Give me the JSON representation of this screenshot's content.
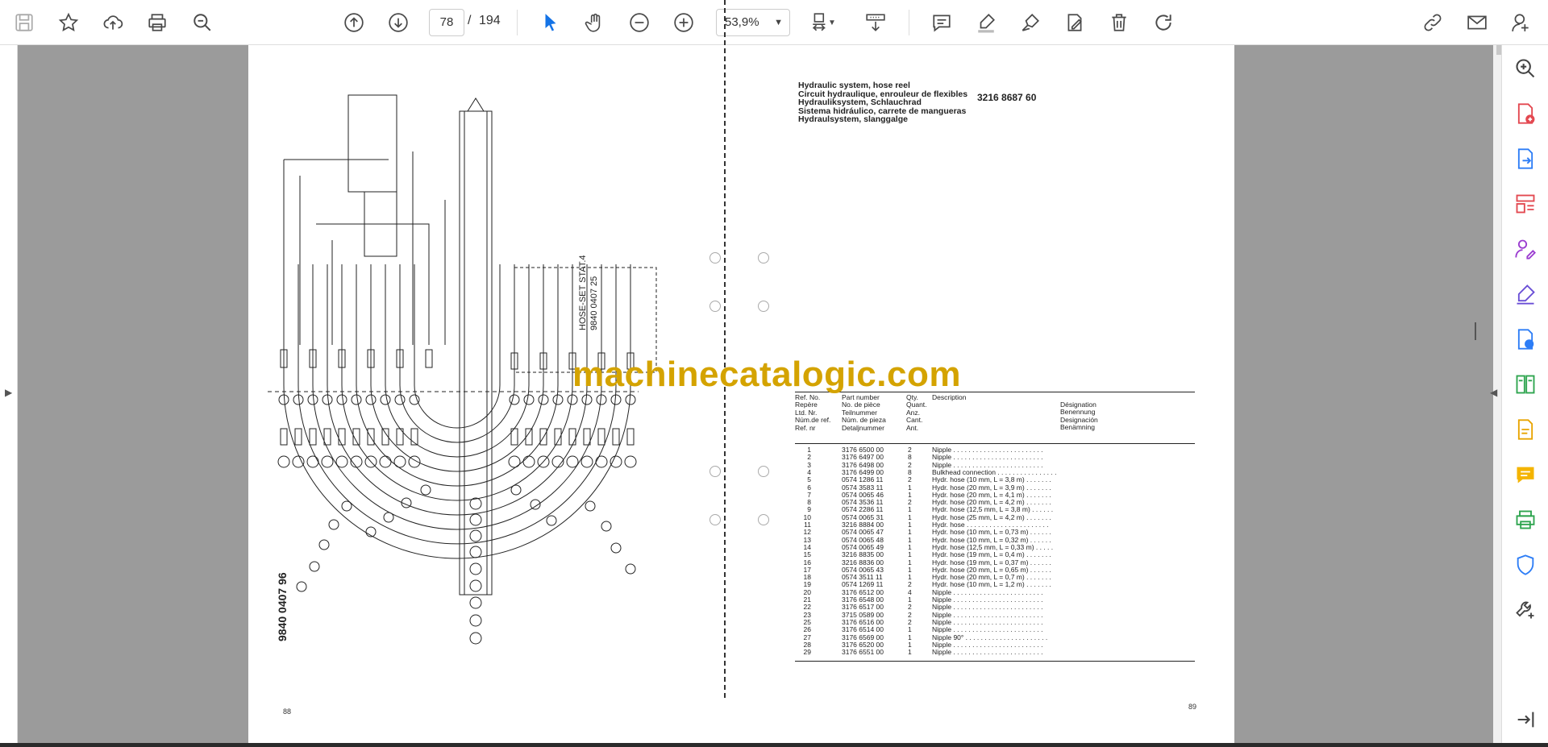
{
  "toolbar": {
    "page_current": "78",
    "page_separator": "/",
    "page_total": "194",
    "zoom": "53,9%",
    "icons": [
      "save-icon",
      "bookmark-star-icon",
      "upload-cloud-icon",
      "print-icon",
      "find-zoom-icon",
      "page-up-icon",
      "page-down-icon",
      "select-cursor-icon",
      "hand-pan-icon",
      "zoom-out-icon",
      "zoom-in-icon",
      "fit-page-icon",
      "scroll-mode-icon",
      "comment-icon",
      "highlight-pen-icon",
      "sign-icon",
      "edit-text-icon",
      "delete-trash-icon",
      "rotate-icon",
      "share-link-icon",
      "email-icon",
      "account-icon"
    ]
  },
  "right_panel": {
    "icons": [
      "zoom-search-icon",
      "create-pdf-icon",
      "export-pdf-icon",
      "organize-pages-icon",
      "request-signature-icon",
      "fill-sign-icon",
      "convert-pdf-icon",
      "compare-icon",
      "edit-pdf-icon",
      "comment-panel-icon",
      "print-production-icon",
      "protect-icon",
      "more-tools-icon",
      "expand-panel-icon"
    ]
  },
  "document": {
    "left_page_number": "88",
    "right_page_number": "89",
    "schematic_label": "9840 0407 96",
    "hoseset_label_1": "HOSE-SET STAT.4",
    "hoseset_label_2": "9840 0407 25",
    "watermark": "machinecatalogic.com",
    "title_lines": [
      "Hydraulic system, hose reel",
      "Circuit hydraulique, enrouleur de flexibles",
      "Hydrauliksystem, Schlauchrad",
      "Sistema hidráulico, carrete de mangueras",
      "Hydraulsystem, slanggalge"
    ],
    "title_part_number": "3216 8687 60",
    "header": {
      "ref": [
        "Ref. No.",
        "Repère",
        "Ltd. Nr.",
        "Núm.de ref.",
        "Ref. nr"
      ],
      "part": [
        "Part number",
        "No. de pièce",
        "Teilnummer",
        "Núm. de pieza",
        "Detaljnummer"
      ],
      "qty": [
        "Qty.",
        "Quant.",
        "Anz.",
        "Cant.",
        "Ant."
      ],
      "desc": "Description",
      "desc_lang": [
        "Désignation",
        "Benennung",
        "Designación",
        "Benämning"
      ]
    },
    "parts": [
      {
        "ref": "1",
        "part": "3176 6500 00",
        "qty": "2",
        "desc": "Nipple . . . . . . . . . . . . . . . . . . . . . . . ."
      },
      {
        "ref": "2",
        "part": "3176 6497 00",
        "qty": "8",
        "desc": "Nipple . . . . . . . . . . . . . . . . . . . . . . . ."
      },
      {
        "ref": "3",
        "part": "3176 6498 00",
        "qty": "2",
        "desc": "Nipple . . . . . . . . . . . . . . . . . . . . . . . ."
      },
      {
        "ref": "4",
        "part": "3176 6499 00",
        "qty": "8",
        "desc": "Bulkhead connection . . . . . . . . . . . . . . . ."
      },
      {
        "ref": "5",
        "part": "0574 1286 11",
        "qty": "2",
        "desc": "Hydr. hose (10 mm, L = 3,8 m) . . . . . . ."
      },
      {
        "ref": "6",
        "part": "0574 3583 11",
        "qty": "1",
        "desc": "Hydr. hose (20 mm, L = 3,9 m) . . . . . . ."
      },
      {
        "ref": "7",
        "part": "0574 0065 46",
        "qty": "1",
        "desc": "Hydr. hose (20 mm, L = 4,1 m) . . . . . . ."
      },
      {
        "ref": "8",
        "part": "0574 3536 11",
        "qty": "2",
        "desc": "Hydr. hose (20 mm, L = 4,2 m) . . . . . . ."
      },
      {
        "ref": "9",
        "part": "0574 2286 11",
        "qty": "1",
        "desc": "Hydr. hose (12,5 mm, L = 3,8 m) . . . . . ."
      },
      {
        "ref": "10",
        "part": "0574 0065 31",
        "qty": "1",
        "desc": "Hydr. hose (25 mm, L = 4,2 m) . . . . . . ."
      },
      {
        "ref": "11",
        "part": "3216 8884 00",
        "qty": "1",
        "desc": "Hydr. hose . . . . . . . . . . . . . . . . . . . . . ."
      },
      {
        "ref": "12",
        "part": "0574 0065 47",
        "qty": "1",
        "desc": "Hydr. hose (10 mm, L = 0,73 m) . . . . . ."
      },
      {
        "ref": "13",
        "part": "0574 0065 48",
        "qty": "1",
        "desc": "Hydr. hose (10 mm, L = 0,32 m) . . . . . ."
      },
      {
        "ref": "14",
        "part": "0574 0065 49",
        "qty": "1",
        "desc": "Hydr. hose (12,5 mm, L = 0,33 m) . . . . ."
      },
      {
        "ref": "15",
        "part": "3216 8835 00",
        "qty": "1",
        "desc": "Hydr. hose (19 mm, L = 0,4 m) . . . . . . ."
      },
      {
        "ref": "16",
        "part": "3216 8836 00",
        "qty": "1",
        "desc": "Hydr. hose (19 mm, L = 0,37 m) . . . . . ."
      },
      {
        "ref": "17",
        "part": "0574 0065 43",
        "qty": "1",
        "desc": "Hydr. hose (20 mm, L = 0,65 m) . . . . . ."
      },
      {
        "ref": "18",
        "part": "0574 3511 11",
        "qty": "1",
        "desc": "Hydr. hose (20 mm, L = 0,7 m) . . . . . . ."
      },
      {
        "ref": "19",
        "part": "0574 1269 11",
        "qty": "2",
        "desc": "Hydr. hose (10 mm, L = 1,2 m) . . . . . . ."
      },
      {
        "ref": "20",
        "part": "3176 6512 00",
        "qty": "4",
        "desc": "Nipple . . . . . . . . . . . . . . . . . . . . . . . ."
      },
      {
        "ref": "21",
        "part": "3176 6548 00",
        "qty": "1",
        "desc": "Nipple . . . . . . . . . . . . . . . . . . . . . . . ."
      },
      {
        "ref": "22",
        "part": "3176 6517 00",
        "qty": "2",
        "desc": "Nipple . . . . . . . . . . . . . . . . . . . . . . . ."
      },
      {
        "ref": "23",
        "part": "3715 0589 00",
        "qty": "2",
        "desc": "Nipple . . . . . . . . . . . . . . . . . . . . . . . ."
      },
      {
        "ref": "25",
        "part": "3176 6516 00",
        "qty": "2",
        "desc": "Nipple . . . . . . . . . . . . . . . . . . . . . . . ."
      },
      {
        "ref": "26",
        "part": "3176 6514 00",
        "qty": "1",
        "desc": "Nipple . . . . . . . . . . . . . . . . . . . . . . . ."
      },
      {
        "ref": "27",
        "part": "3176 6569 00",
        "qty": "1",
        "desc": "Nipple 90° . . . . . . . . . . . . . . . . . . . . . ."
      },
      {
        "ref": "28",
        "part": "3176 6520 00",
        "qty": "1",
        "desc": "Nipple . . . . . . . . . . . . . . . . . . . . . . . ."
      },
      {
        "ref": "29",
        "part": "3176 6551 00",
        "qty": "1",
        "desc": "Nipple . . . . . . . . . . . . . . . . . . . . . . . ."
      }
    ]
  }
}
